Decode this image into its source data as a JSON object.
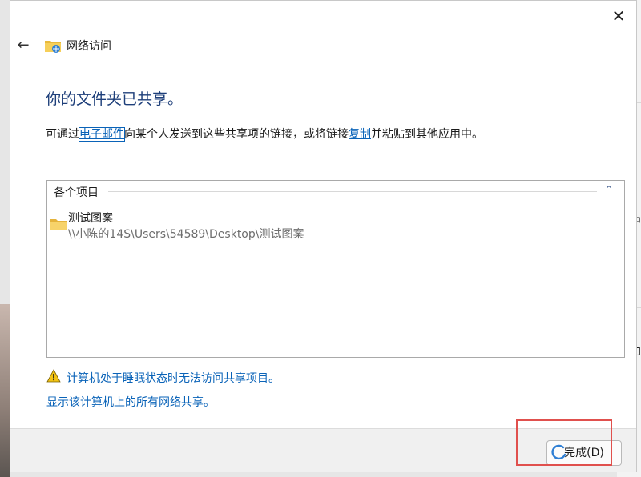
{
  "window": {
    "close_glyph": "✕",
    "back_glyph": "←",
    "title": "网络访问",
    "icon": "network-folder-icon"
  },
  "main": {
    "heading": "你的文件夹已共享。",
    "desc_before": "可通过",
    "email_link": "电子邮件",
    "desc_middle": "向某个人发送到这些共享项的链接，或将链接",
    "copy_link": "复制",
    "desc_after": "并粘贴到其他应用中。"
  },
  "items_group": {
    "header": "各个项目",
    "collapse_glyph": "⌃",
    "items": [
      {
        "name": "测试图案",
        "path": "\\\\小陈的14S\\Users\\54589\\Desktop\\测试图案",
        "icon": "folder-icon"
      }
    ]
  },
  "links": {
    "sleep_warning": "计算机处于睡眠状态时无法访问共享项目。",
    "show_all_shares": "显示该计算机上的所有网络共享。"
  },
  "footer": {
    "finish_label": "完成(D)"
  },
  "background_window": {
    "glyph_1": "中",
    "glyph_2": "印"
  },
  "colors": {
    "accent": "#0a63b8",
    "heading": "#1e3f7a",
    "highlight": "#e0504d"
  }
}
